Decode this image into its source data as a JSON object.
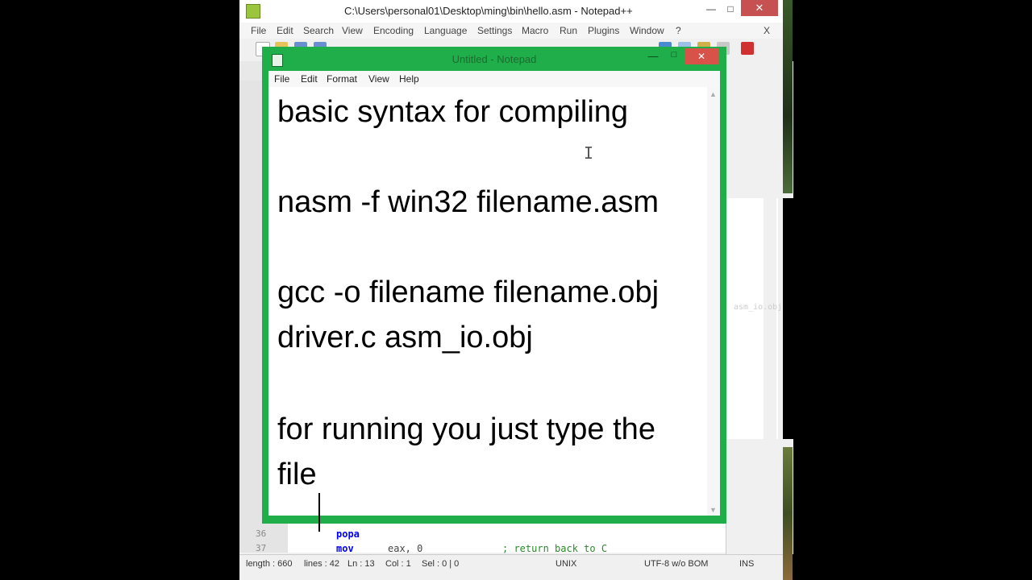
{
  "npp": {
    "title": "C:\\Users\\personal01\\Desktop\\ming\\bin\\hello.asm - Notepad++",
    "menu": [
      "File",
      "Edit",
      "Search",
      "View",
      "Encoding",
      "Language",
      "Settings",
      "Macro",
      "Run",
      "Plugins",
      "Window",
      "?"
    ],
    "close_x": "X",
    "gutter_lines": [
      "36",
      "37"
    ],
    "code": {
      "line36": "popa",
      "line37_instr": "mov",
      "line37_args": "eax, 0",
      "line37_comment": "; return back to C"
    },
    "status": {
      "length": "length : 660",
      "lines": "lines : 42",
      "ln": "Ln : 13",
      "col": "Col : 1",
      "sel": "Sel : 0 | 0",
      "eol": "UNIX",
      "encoding": "UTF-8 w/o BOM",
      "mode": "INS"
    }
  },
  "console": {
    "text": "asm_io.obj"
  },
  "notepad": {
    "title": "Untitled - Notepad",
    "menu": [
      "File",
      "Edit",
      "Format",
      "View",
      "Help"
    ],
    "lines": [
      "basic syntax for compiling",
      "",
      "nasm -f win32 filename.asm",
      "",
      "gcc -o filename filename.obj",
      "driver.c asm_io.obj",
      "",
      "for running you just type the",
      "file"
    ]
  },
  "colors": {
    "notepad_frame": "#1fae4a",
    "npp_close": "#c75050",
    "keyword": "#0000ff"
  }
}
